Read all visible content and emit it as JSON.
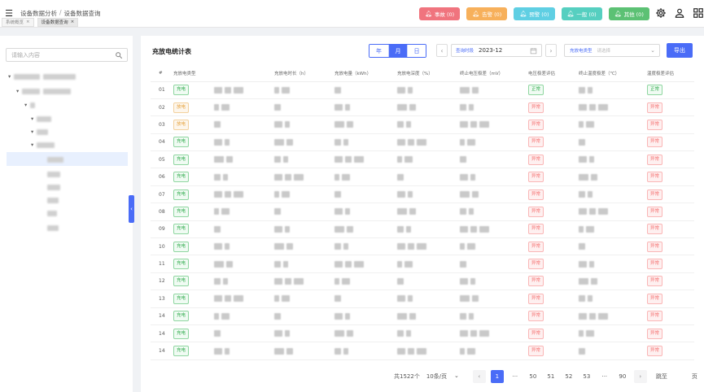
{
  "breadcrumb": [
    "设备数据分析",
    "设备数据查询"
  ],
  "tabs": [
    {
      "label": "系统概览"
    },
    {
      "label": "设备数据查询"
    }
  ],
  "alerts": [
    {
      "label": "事故 (0)",
      "color": "#f0747e"
    },
    {
      "label": "告警 (0)",
      "color": "#f7b05b"
    },
    {
      "label": "预警 (0)",
      "color": "#5fcfe3"
    },
    {
      "label": "一般 (0)",
      "color": "#56cfc0"
    },
    {
      "label": "其他 (0)",
      "color": "#5cc174"
    }
  ],
  "sidebar": {
    "search_placeholder": "请输入内容"
  },
  "toolbar": {
    "title": "充放电统计表",
    "ymd": [
      "年",
      "月",
      "日"
    ],
    "ymd_active": "月",
    "date_label": "查询时段",
    "date_value": "2023-12",
    "type_label": "充放电类型",
    "type_placeholder": "请选择",
    "export_label": "导出"
  },
  "table": {
    "headers": [
      "#",
      "充放电类型",
      "",
      "充放电时长（h）",
      "充放电量（kWh）",
      "充放电深度（%）",
      "终止电压极差（mV）",
      "电压极差评估",
      "终止温度极差（℃）",
      "温度极差评估"
    ],
    "rows": [
      {
        "no": "01",
        "type": "充电",
        "type_status": "green",
        "volt_eval": "正常",
        "volt_status": "green",
        "temp_eval": "正常",
        "temp_status": "green"
      },
      {
        "no": "02",
        "type": "放电",
        "type_status": "orange",
        "volt_eval": "异常",
        "volt_status": "red",
        "temp_eval": "异常",
        "temp_status": "red"
      },
      {
        "no": "03",
        "type": "放电",
        "type_status": "orange",
        "volt_eval": "异常",
        "volt_status": "red",
        "temp_eval": "异常",
        "temp_status": "red"
      },
      {
        "no": "04",
        "type": "充电",
        "type_status": "green",
        "volt_eval": "异常",
        "volt_status": "red",
        "temp_eval": "异常",
        "temp_status": "red"
      },
      {
        "no": "05",
        "type": "充电",
        "type_status": "green",
        "volt_eval": "异常",
        "volt_status": "red",
        "temp_eval": "异常",
        "temp_status": "red"
      },
      {
        "no": "06",
        "type": "充电",
        "type_status": "green",
        "volt_eval": "异常",
        "volt_status": "red",
        "temp_eval": "异常",
        "temp_status": "red"
      },
      {
        "no": "07",
        "type": "充电",
        "type_status": "green",
        "volt_eval": "异常",
        "volt_status": "red",
        "temp_eval": "异常",
        "temp_status": "red"
      },
      {
        "no": "08",
        "type": "充电",
        "type_status": "green",
        "volt_eval": "异常",
        "volt_status": "red",
        "temp_eval": "异常",
        "temp_status": "red"
      },
      {
        "no": "09",
        "type": "充电",
        "type_status": "green",
        "volt_eval": "异常",
        "volt_status": "red",
        "temp_eval": "异常",
        "temp_status": "red"
      },
      {
        "no": "10",
        "type": "充电",
        "type_status": "green",
        "volt_eval": "异常",
        "volt_status": "red",
        "temp_eval": "异常",
        "temp_status": "red"
      },
      {
        "no": "11",
        "type": "充电",
        "type_status": "green",
        "volt_eval": "异常",
        "volt_status": "red",
        "temp_eval": "异常",
        "temp_status": "red"
      },
      {
        "no": "12",
        "type": "充电",
        "type_status": "green",
        "volt_eval": "异常",
        "volt_status": "red",
        "temp_eval": "异常",
        "temp_status": "red"
      },
      {
        "no": "13",
        "type": "充电",
        "type_status": "green",
        "volt_eval": "异常",
        "volt_status": "red",
        "temp_eval": "异常",
        "temp_status": "red"
      },
      {
        "no": "14",
        "type": "充电",
        "type_status": "green",
        "volt_eval": "异常",
        "volt_status": "red",
        "temp_eval": "异常",
        "temp_status": "red"
      },
      {
        "no": "14",
        "type": "充电",
        "type_status": "green",
        "volt_eval": "异常",
        "volt_status": "red",
        "temp_eval": "异常",
        "temp_status": "red"
      },
      {
        "no": "14",
        "type": "充电",
        "type_status": "green",
        "volt_eval": "异常",
        "volt_status": "red",
        "temp_eval": "异常",
        "temp_status": "red"
      }
    ]
  },
  "pager": {
    "total": "共1522个",
    "page_size": "10条/页",
    "pages": [
      "1",
      "···",
      "50",
      "51",
      "52",
      "53",
      "···",
      "90"
    ],
    "active_page": "1",
    "goto_label": "跳至",
    "goto_unit": "页"
  }
}
